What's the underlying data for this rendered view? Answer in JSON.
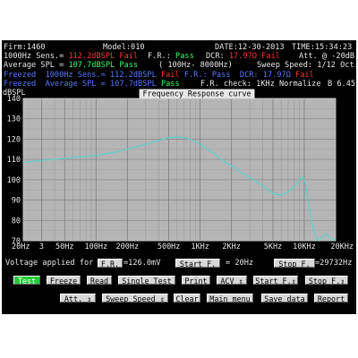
{
  "header": {
    "firm": "Firm:1460",
    "model": "Model:010",
    "date": "DATE:12-30-2013",
    "time": "TIME:15:34:23"
  },
  "line2": {
    "sens_label": "1000Hz Sens.= ",
    "sens_value": "112.2dBSPL",
    "sens_status": "Fail",
    "fr_label": "F.R.: ",
    "fr_status": "Pass",
    "dcr_label": "DCR: ",
    "dcr_value": "17.97Ω",
    "dcr_status": "Fail",
    "att_label": "Att. @ -20dB"
  },
  "line3": {
    "avg_label": "Average SPL = ",
    "avg_value": "107.7dBSPL",
    "avg_status": "Pass",
    "range": "( 100Hz- 8000Hz)",
    "sweep_label": "Sweep Speed: 1/12 Oct."
  },
  "frozen_line1": {
    "text_a": "Freezed  1000Hz Sens.= ",
    "value": "112.2dBSPL",
    "status": "Fail",
    "fr_label": " F.R.: Pass",
    "dcr_label": "  DCR: ",
    "dcr_value": "17.97Ω",
    "dcr_status": "Fail"
  },
  "frozen_line2": {
    "text_a": "Freezed  Average SPL = ",
    "value": "107.7dBSPL",
    "status": "Pass",
    "check": "F.R. check: 1KHz Normalize",
    "version": "B 6.45"
  },
  "chart_data": {
    "type": "line",
    "title": "Frequency Response curve",
    "ylabel": "dBSPL",
    "x_scale": "log",
    "xlim": [
      20,
      20000
    ],
    "ylim": [
      70,
      140
    ],
    "y_ticks": [
      70,
      80,
      90,
      100,
      110,
      120,
      130,
      140
    ],
    "x_tick_labels": [
      "20Hz",
      "3",
      "50Hz",
      "100Hz",
      "200Hz",
      "500Hz",
      "1KHz",
      "2KHz",
      "5KHz",
      "10KHz",
      "20KHz"
    ],
    "x_tick_values": [
      20,
      30,
      50,
      100,
      200,
      500,
      1000,
      2000,
      5000,
      10000,
      20000
    ],
    "grid": true,
    "curve_color": "#5fd0c8",
    "series": [
      {
        "x": [
          20,
          30,
          50,
          70,
          100,
          150,
          200,
          300,
          400,
          500,
          600,
          700,
          800,
          1000,
          1300,
          1600,
          2000,
          2500,
          3000,
          4000,
          5000,
          5500,
          6000,
          7000,
          8000,
          9000,
          9500,
          10000,
          10500,
          11000,
          12000,
          13000,
          14000,
          15000,
          16000,
          17000,
          18000,
          19000,
          20000
        ],
        "y": [
          108.5,
          109.6,
          110.5,
          111.2,
          112.0,
          113.5,
          115.0,
          117.5,
          119.3,
          120.7,
          121.0,
          120.8,
          120.0,
          117.6,
          113.5,
          110.0,
          106.7,
          103.5,
          101.3,
          97.0,
          93.2,
          92.8,
          92.5,
          94.0,
          96.7,
          99.7,
          101.3,
          100.2,
          95.5,
          88.0,
          77.5,
          71.0,
          70.0,
          72.2,
          73.5,
          72.5,
          70.3,
          70.5,
          71.0
        ]
      }
    ]
  },
  "voltage": {
    "label": "Voltage applied for",
    "fr_button": "F.R.",
    "fr_value": "=126.0mV",
    "start_button": "Start F.",
    "start_value": "= 20Hz",
    "stop_button": "Stop F.",
    "stop_value": "=29732Hz"
  },
  "buttons_row1": [
    "Test",
    "Freeze",
    "Read",
    "Single Test",
    "Print",
    "ACV ⇕",
    "Start F.⇕",
    "Stop F.⇕"
  ],
  "buttons_row2": [
    "Att. ⇕",
    "Sweep Speed ⇕",
    "Clear",
    "Main menu",
    "Save data",
    "Report"
  ]
}
